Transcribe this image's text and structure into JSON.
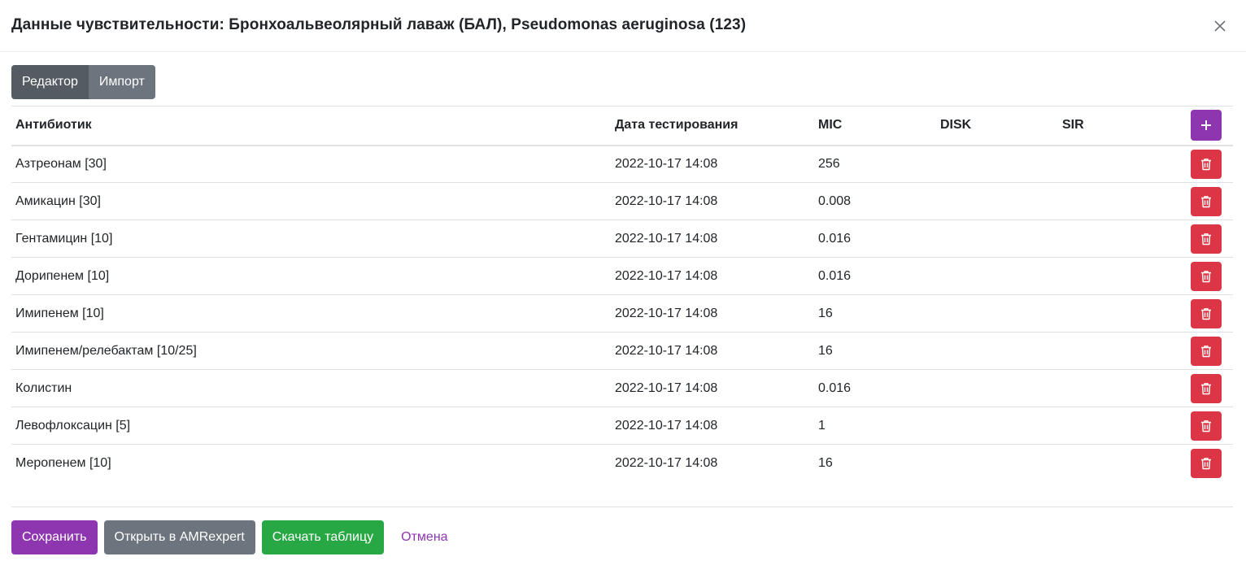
{
  "modal": {
    "title": "Данные чувствительности: Бронхоальвеолярный лаваж (БАЛ), Pseudomonas aeruginosa (123)"
  },
  "tabs": [
    {
      "label": "Редактор",
      "active": true
    },
    {
      "label": "Импорт",
      "active": false
    }
  ],
  "table": {
    "headers": {
      "antibiotic": "Антибиотик",
      "date": "Дата тестирования",
      "mic": "MIC",
      "disk": "DISK",
      "sir": "SIR"
    },
    "rows": [
      {
        "antibiotic": "Азтреонам [30]",
        "date": "2022-10-17 14:08",
        "mic": "256",
        "disk": "",
        "sir": ""
      },
      {
        "antibiotic": "Амикацин [30]",
        "date": "2022-10-17 14:08",
        "mic": "0.008",
        "disk": "",
        "sir": ""
      },
      {
        "antibiotic": "Гентамицин [10]",
        "date": "2022-10-17 14:08",
        "mic": "0.016",
        "disk": "",
        "sir": ""
      },
      {
        "antibiotic": "Дорипенем [10]",
        "date": "2022-10-17 14:08",
        "mic": "0.016",
        "disk": "",
        "sir": ""
      },
      {
        "antibiotic": "Имипенем [10]",
        "date": "2022-10-17 14:08",
        "mic": "16",
        "disk": "",
        "sir": ""
      },
      {
        "antibiotic": "Имипенем/релебактам [10/25]",
        "date": "2022-10-17 14:08",
        "mic": "16",
        "disk": "",
        "sir": ""
      },
      {
        "antibiotic": "Колистин",
        "date": "2022-10-17 14:08",
        "mic": "0.016",
        "disk": "",
        "sir": ""
      },
      {
        "antibiotic": "Левофлоксацин [5]",
        "date": "2022-10-17 14:08",
        "mic": "1",
        "disk": "",
        "sir": ""
      },
      {
        "antibiotic": "Меропенем [10]",
        "date": "2022-10-17 14:08",
        "mic": "16",
        "disk": "",
        "sir": ""
      }
    ]
  },
  "footer": {
    "save_label": "Сохранить",
    "open_label": "Открыть в AMRexpert",
    "download_label": "Скачать таблицу",
    "cancel_label": "Отмена"
  },
  "icons": {
    "close": "close-icon",
    "add": "plus-icon",
    "delete": "trash-icon"
  },
  "colors": {
    "primary": "#8e35b0",
    "danger": "#dc3545",
    "secondary": "#6c757d",
    "success": "#28a745"
  }
}
